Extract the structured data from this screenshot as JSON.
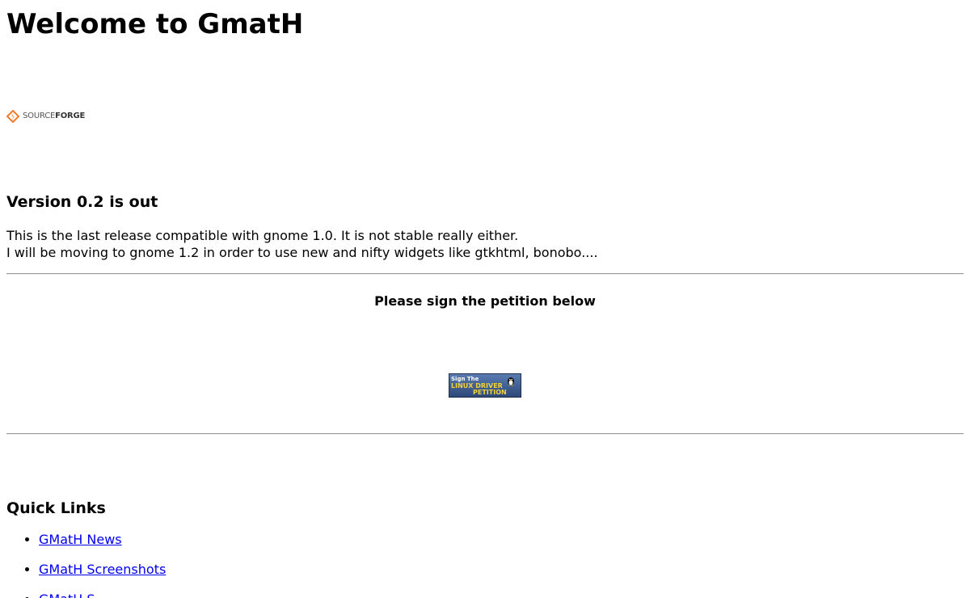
{
  "page": {
    "title": "Welcome to GmatH"
  },
  "sourceforge_logo": {
    "text_source": "SOURCE",
    "text_forge": "FORGE",
    "accent_color": "#f07b2a"
  },
  "news": {
    "heading": "Version 0.2 is out",
    "line1": "This is the last release compatible with gnome 1.0. It is not stable really either.",
    "line2": "I will be moving to gnome 1.2 in order to use new and nifty widgets like gtkhtml, bonobo...."
  },
  "petition": {
    "text": "Please sign the petition below",
    "banner_line1": "Sign The",
    "banner_line2": "LINUX DRIVER",
    "banner_line3": "PETITION"
  },
  "quick_links": {
    "heading": "Quick Links",
    "items": [
      {
        "label": "GMatH News"
      },
      {
        "label": "GMatH Screenshots"
      },
      {
        "label": "GMatH S..."
      }
    ]
  },
  "colors": {
    "link": "#0000ee",
    "rule": "#999999",
    "banner_bg": "#3a5a8c",
    "banner_text_yellow": "#f2d23a"
  }
}
